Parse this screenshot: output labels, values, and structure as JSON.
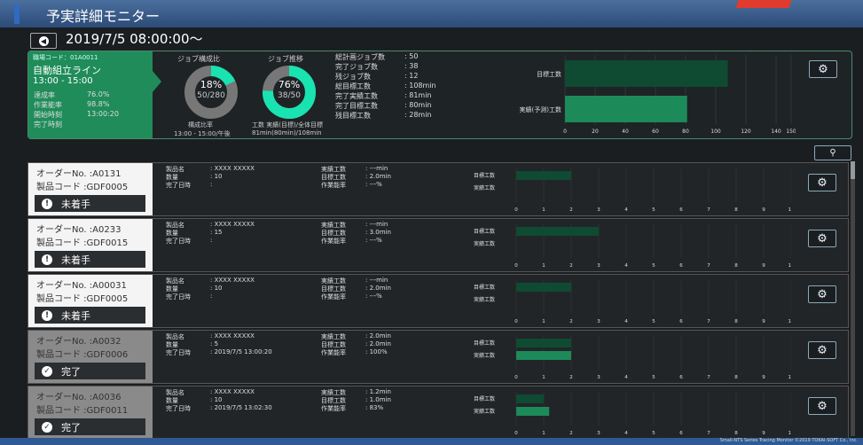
{
  "header": {
    "title": "予実詳細モニター"
  },
  "date_bar": {
    "datetime": "2019/7/5 08:00:00〜"
  },
  "line": {
    "code_label": "職場コード：01A0011",
    "name": "自動組立ライン",
    "hours": "13:00 - 15:00",
    "stats": [
      {
        "label": "達成率",
        "value": "76.0%"
      },
      {
        "label": "作業能率",
        "value": "98.8%"
      },
      {
        "label": "開始時刻",
        "value": "13:00:20"
      },
      {
        "label": "完了時刻",
        "value": ""
      }
    ]
  },
  "composition": {
    "title": "ジョブ構成比",
    "percent": "18%",
    "fraction": "50/280",
    "fill": 0.18,
    "caption1": "構成比率",
    "caption2": "13:00 - 15:00/午後"
  },
  "progress": {
    "title": "ジョブ推移",
    "percent": "76%",
    "fraction": "38/50",
    "fill": 0.76,
    "caption1": "工数 実績(目標)/全体目標",
    "caption2": "81min(80min)/108min"
  },
  "job_stats": [
    {
      "label": "総計画ジョブ数",
      "value": ": 50"
    },
    {
      "label": "完了ジョブ数",
      "value": ": 38"
    },
    {
      "label": "残ジョブ数",
      "value": ": 12"
    },
    {
      "label": "総目標工数",
      "value": ": 108min"
    },
    {
      "label": "完了実績工数",
      "value": ": 81min"
    },
    {
      "label": "完了目標工数",
      "value": ": 80min"
    },
    {
      "label": "残目標工数",
      "value": ": 28min"
    }
  ],
  "summary_chart": {
    "rows": [
      {
        "label": "目標工数",
        "value": 108
      },
      {
        "label": "実績(予測)工数",
        "value": 81
      }
    ],
    "ticks": [
      "0",
      "20",
      "40",
      "60",
      "80",
      "100",
      "120",
      "140",
      "150"
    ],
    "max": 150
  },
  "orders": [
    {
      "order_no": "オーダーNo. :A0131",
      "product_code": "製品コード :GDF0005",
      "status": "未着手",
      "done": false,
      "product_name": ": XXXX XXXXX",
      "qty": ": 10",
      "finish": ":",
      "actual": ": ---min",
      "target": ": 2.0min",
      "efficiency": ": ---%",
      "target_val": 2.0,
      "actual_val": 0
    },
    {
      "order_no": "オーダーNo. :A0233",
      "product_code": "製品コード :GDF0015",
      "status": "未着手",
      "done": false,
      "product_name": ": XXXX XXXXX",
      "qty": ": 15",
      "finish": ":",
      "actual": ": ---min",
      "target": ": 3.0min",
      "efficiency": ": ---%",
      "target_val": 3.0,
      "actual_val": 0
    },
    {
      "order_no": "オーダーNo. :A00031",
      "product_code": "製品コード :GDF0005",
      "status": "未着手",
      "done": false,
      "product_name": ": XXXX XXXXX",
      "qty": ": 10",
      "finish": ":",
      "actual": ": ---min",
      "target": ": 2.0min",
      "efficiency": ": ---%",
      "target_val": 2.0,
      "actual_val": 0
    },
    {
      "order_no": "オーダーNo. :A0032",
      "product_code": "製品コード :GDF0006",
      "status": "完了",
      "done": true,
      "product_name": ": XXXX XXXXX",
      "qty": ": 5",
      "finish": ": 2019/7/5 13:00:20",
      "actual": ": 2.0min",
      "target": ": 2.0min",
      "efficiency": ": 100%",
      "target_val": 2.0,
      "actual_val": 2.0
    },
    {
      "order_no": "オーダーNo. :A0036",
      "product_code": "製品コード :GDF0011",
      "status": "完了",
      "done": true,
      "product_name": ": XXXX XXXXX",
      "qty": ": 10",
      "finish": ": 2019/7/5 13:02:30",
      "actual": ": 1.2min",
      "target": ": 1.0min",
      "efficiency": ": 83%",
      "target_val": 1.0,
      "actual_val": 1.2
    }
  ],
  "order_labels": {
    "product_name": "製品名",
    "qty": "数量",
    "finish": "完了日時",
    "actual": "実績工数",
    "target": "目標工数",
    "efficiency": "作業能率",
    "chart_target": "目標工数",
    "chart_actual": "実績工数"
  },
  "order_ticks": [
    "0",
    "1",
    "2",
    "3",
    "4",
    "5",
    "6",
    "7",
    "8",
    "9",
    "10"
  ],
  "footer": {
    "text": "Small-NTS Series Tracing Monitor ©2019 TOKAI-SOFT Co., Inc."
  },
  "colors": {
    "accent_green": "#1f8c5a",
    "bar_green": "#1d8a5a",
    "bar_dark_green": "#0f4a33"
  }
}
